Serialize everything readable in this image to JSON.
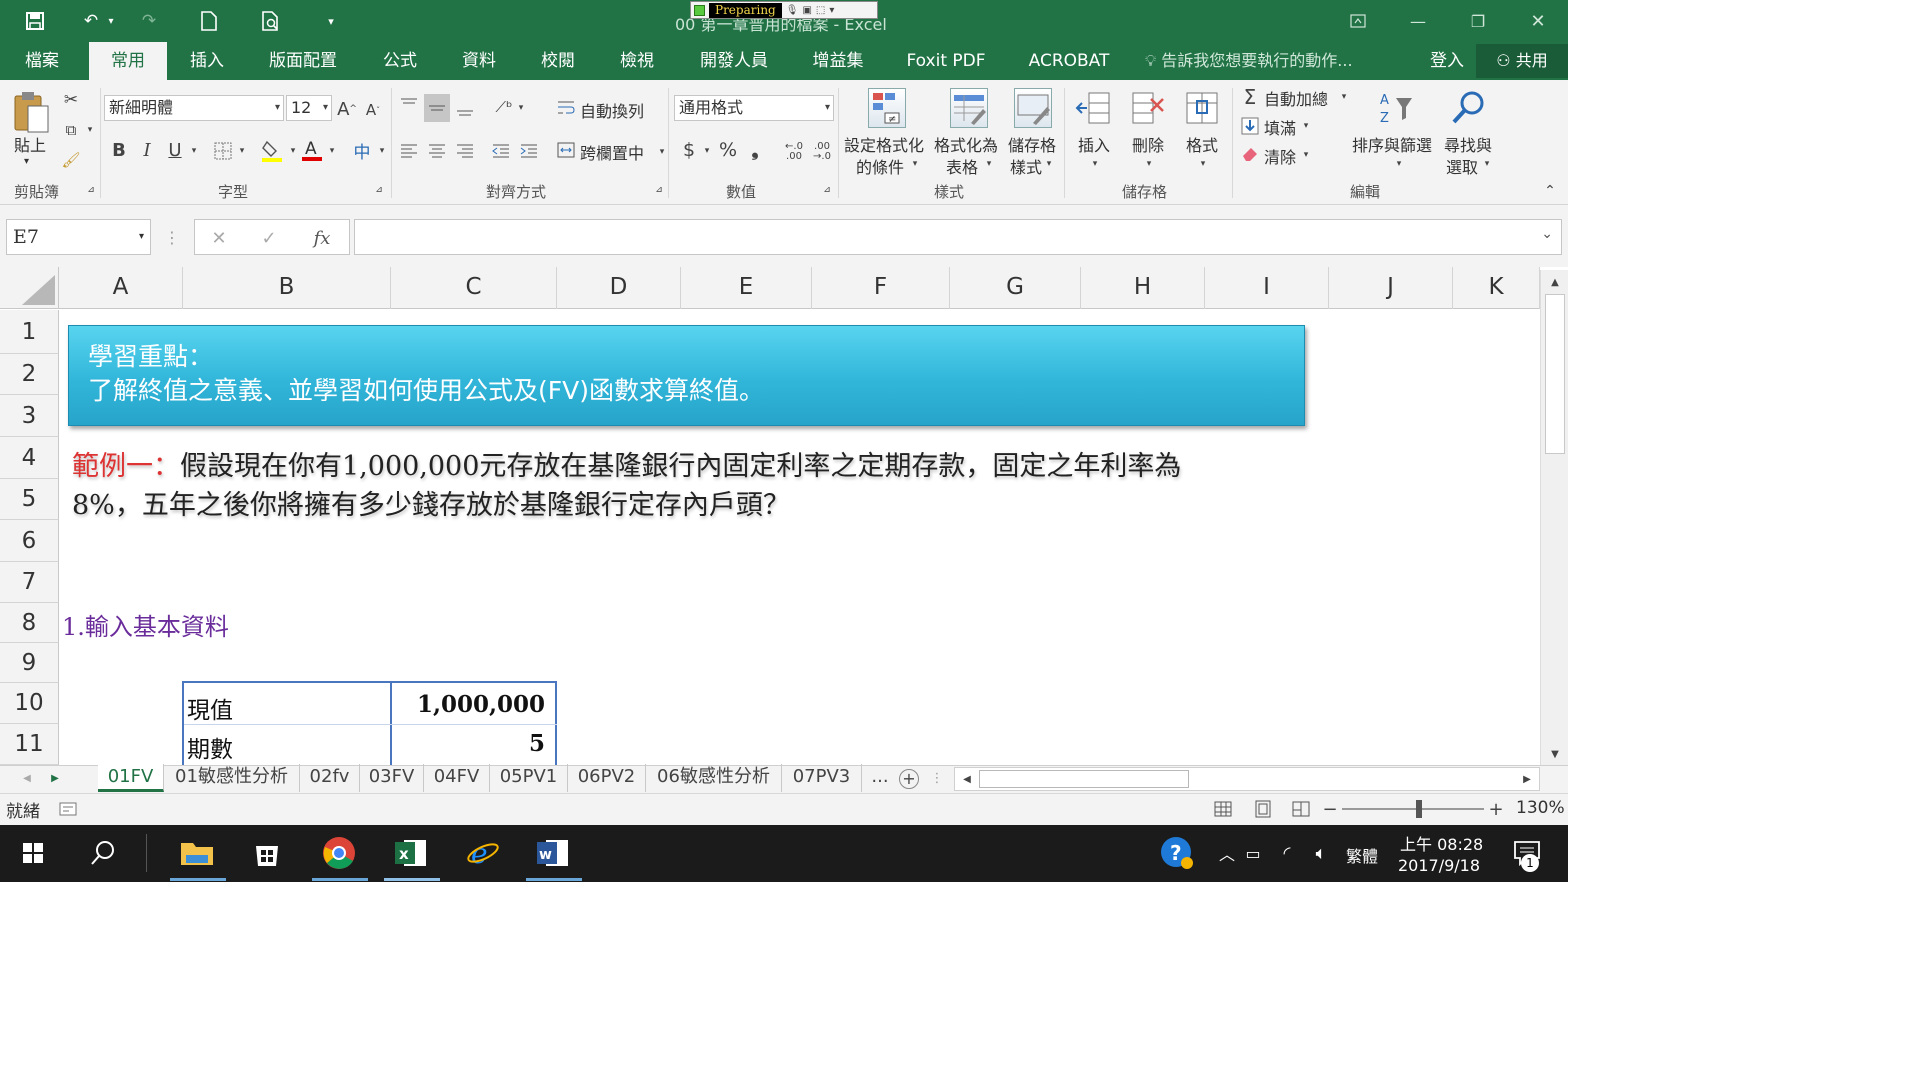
{
  "titlebar": {
    "title": "00 第一章普用的檔案 - Excel",
    "recorder_label": "Preparing"
  },
  "menu": {
    "tabs": [
      "檔案",
      "常用",
      "插入",
      "版面配置",
      "公式",
      "資料",
      "校閱",
      "檢視",
      "開發人員",
      "增益集",
      "Foxit PDF",
      "ACROBAT"
    ],
    "active": "常用",
    "tell_me": "告訴我您想要執行的動作...",
    "signin": "登入",
    "share": "共用"
  },
  "ribbon": {
    "clipboard": {
      "paste": "貼上",
      "group": "剪貼簿"
    },
    "font": {
      "name": "新細明體",
      "size": "12",
      "group": "字型",
      "bold": "B",
      "italic": "I",
      "underline": "U",
      "phonetic": "中"
    },
    "alignment": {
      "wrap": "自動換列",
      "merge": "跨欄置中",
      "group": "對齊方式"
    },
    "number": {
      "format": "通用格式",
      "group": "數值",
      "currency": "$",
      "percent": "%",
      "comma": "❟"
    },
    "styles": {
      "conditional_l1": "設定格式化",
      "conditional_l2": "的條件",
      "table_l1": "格式化為",
      "table_l2": "表格",
      "cell_l1": "儲存格",
      "cell_l2": "樣式",
      "group": "樣式"
    },
    "cells": {
      "insert": "插入",
      "delete": "刪除",
      "format": "格式",
      "group": "儲存格"
    },
    "editing": {
      "autosum": "自動加總",
      "fill": "填滿",
      "clear": "清除",
      "sort_filter": "排序與篩選",
      "find_l1": "尋找與",
      "find_l2": "選取",
      "group": "編輯"
    }
  },
  "formula_bar": {
    "name_box": "E7",
    "fx": "fx",
    "value": ""
  },
  "columns": [
    "A",
    "B",
    "C",
    "D",
    "E",
    "F",
    "G",
    "H",
    "I",
    "J",
    "K"
  ],
  "rows": [
    "1",
    "2",
    "3",
    "4",
    "5",
    "6",
    "7",
    "8",
    "9",
    "10",
    "11"
  ],
  "sheet": {
    "banner_title": "學習重點：",
    "banner_text": "了解終值之意義、並學習如何使用公式及(FV)函數求算終值。",
    "example_label": "範例一：",
    "example_line1": "假設現在你有1,000,000元存放在基隆銀行內固定利率之定期存款，固定之年利率為",
    "example_line2": "8%，五年之後你將擁有多少錢存放於基隆銀行定存內戶頭？",
    "section1": "1.輸入基本資料",
    "table": [
      {
        "label": "現值",
        "value": "1,000,000"
      },
      {
        "label": "期數",
        "value": "5"
      }
    ]
  },
  "sheet_tabs": [
    "01FV",
    "01敏感性分析",
    "02fv",
    "03FV",
    "04FV",
    "05PV1",
    "06PV2",
    "06敏感性分析",
    "07PV3",
    "..."
  ],
  "active_sheet": "01FV",
  "status": {
    "ready": "就緒",
    "zoom": "130%"
  },
  "taskbar": {
    "ime": "繁體",
    "time": "上午 08:28",
    "date": "2017/9/18",
    "notifications": "1"
  }
}
